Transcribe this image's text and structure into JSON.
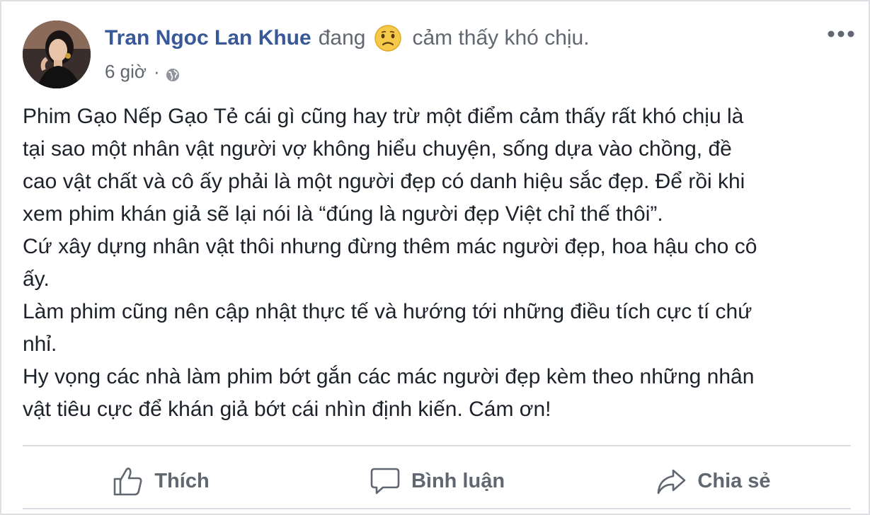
{
  "post": {
    "author": "Tran Ngoc Lan Khue",
    "activity_verb": "đang",
    "feeling_icon": "sad-face-emoji-icon",
    "feeling_text": "cảm thấy khó chịu.",
    "timestamp": "6 giờ",
    "separator": "·",
    "privacy_icon": "globe-icon",
    "body_lines": [
      "Phim Gạo Nếp Gạo Tẻ cái gì cũng hay trừ một điểm cảm thấy rất khó chịu là",
      "tại sao một nhân vật người vợ không hiểu chuyện, sống dựa vào chồng, đề",
      "cao vật chất và cô ấy phải là một người đẹp có danh hiệu sắc đẹp. Để rồi khi",
      "xem phim khán giả sẽ lại nói là “đúng là người đẹp Việt chỉ thế thôi”.",
      "Cứ xây dựng nhân vật thôi nhưng đừng thêm mác người đẹp, hoa hậu cho cô",
      "ấy.",
      "Làm phim cũng nên cập nhật thực tế và hướng tới những điều tích cực tí chứ",
      "nhỉ.",
      "Hy vọng các nhà làm phim bớt gắn các mác người đẹp kèm theo những nhân",
      "vật tiêu cực để khán giả bớt cái nhìn định kiến. Cám ơn!"
    ]
  },
  "actions": {
    "like_label": "Thích",
    "comment_label": "Bình luận",
    "share_label": "Chia sẻ"
  },
  "colors": {
    "author": "#385898",
    "secondary_text": "#616770",
    "body_text": "#1d2129",
    "divider": "#dadde1"
  }
}
